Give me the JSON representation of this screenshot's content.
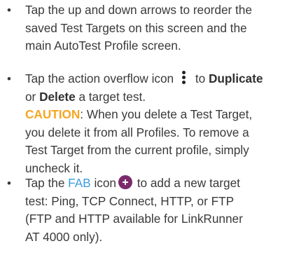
{
  "bullets": [
    {
      "lines": [
        "Tap the up and down arrows to reorder the",
        "saved Test Targets on this screen and the",
        "main AutoTest Profile screen."
      ]
    },
    {
      "line1_pre": "Tap the action overflow icon",
      "line1_post": "to",
      "duplicate": "Duplicate",
      "line2_or": "or",
      "delete": "Delete",
      "line2_post": "a target test.",
      "caution_label": "CAUTION",
      "caution_lines_first": ": When you delete a Test Target,",
      "caution_lines": [
        "you delete it from all Profiles. To remove a",
        "Test Target from the current profile, simply",
        "uncheck it."
      ]
    },
    {
      "line1_pre": "Tap the",
      "fab_link": "FAB",
      "line1_mid": "icon",
      "line1_post": "to add a new target",
      "lines": [
        "test: Ping, TCP Connect, HTTP, or FTP",
        "(FTP and HTTP available for LinkRunner",
        "AT 4000 only)."
      ]
    }
  ],
  "bullet_glyph": "•",
  "icons": {
    "overflow": "kebab-icon",
    "fab": "add-fab-icon"
  },
  "colors": {
    "caution": "#f5a623",
    "link": "#3b9ee0",
    "fab": "#7b2a6b",
    "text": "#3a3a3a"
  }
}
